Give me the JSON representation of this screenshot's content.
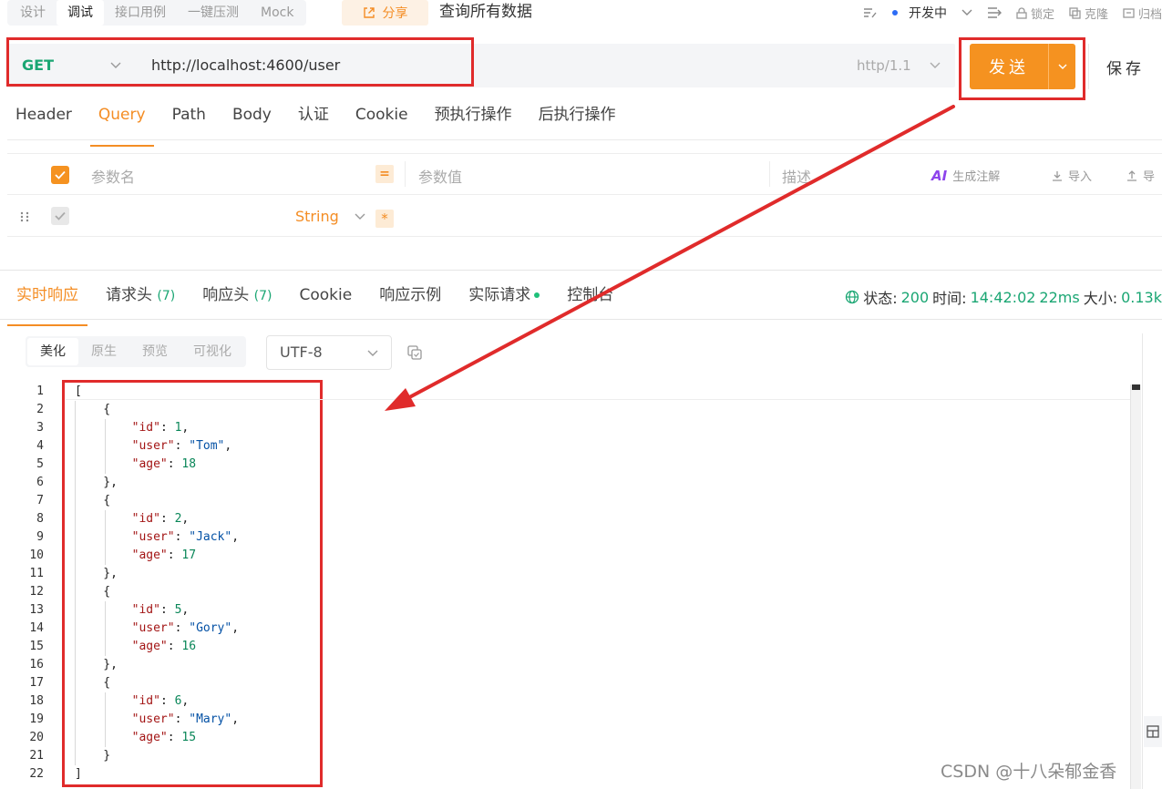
{
  "mode_tabs": [
    "设计",
    "调试",
    "接口用例",
    "一键压测",
    "Mock"
  ],
  "share_label": "分享",
  "page_title": "查询所有数据",
  "top_actions": {
    "env": "开发中",
    "lock": "锁定",
    "clone": "克隆",
    "archive": "归档"
  },
  "request": {
    "method": "GET",
    "url": "http://localhost:4600/user",
    "protocol": "http/1.1",
    "send_label": "发送",
    "save_label": "保存"
  },
  "request_tabs": [
    "Header",
    "Query",
    "Path",
    "Body",
    "认证",
    "Cookie",
    "预执行操作",
    "后执行操作"
  ],
  "param_table": {
    "name_placeholder": "参数名",
    "value_placeholder": "参数值",
    "desc_placeholder": "描述",
    "ai_label": "生成注解",
    "import_label": "导入",
    "export_label": "导",
    "row_type": "String",
    "required_mark": "*"
  },
  "response_tabs": {
    "realtime": "实时响应",
    "req_headers": "请求头",
    "req_headers_count": "(7)",
    "resp_headers": "响应头",
    "resp_headers_count": "(7)",
    "cookie": "Cookie",
    "example": "响应示例",
    "actual": "实际请求",
    "console": "控制台"
  },
  "status": {
    "status_label": "状态:",
    "status_code": "200",
    "time_label": "时间:",
    "time_value": "14:42:02",
    "duration": "22ms",
    "size_label": "大小:",
    "size_value": "0.13k"
  },
  "format_tabs": [
    "美化",
    "原生",
    "预览",
    "可视化"
  ],
  "encoding": "UTF-8",
  "response_body": [
    {
      "id": 1,
      "user": "Tom",
      "age": 18
    },
    {
      "id": 2,
      "user": "Jack",
      "age": 17
    },
    {
      "id": 5,
      "user": "Gory",
      "age": 16
    },
    {
      "id": 6,
      "user": "Mary",
      "age": 15
    }
  ],
  "watermark": "CSDN @十八朵郁金香",
  "colors": {
    "accent": "#f59220",
    "method_get": "#1aa673",
    "annotation_red": "#e02b2b"
  }
}
